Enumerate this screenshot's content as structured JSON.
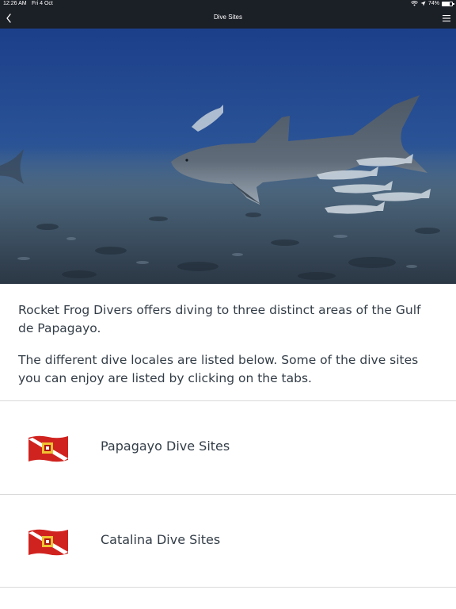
{
  "status_bar": {
    "time": "12:26 AM",
    "date": "Fri 4 Oct",
    "battery": "74%",
    "battery_fraction": 0.74
  },
  "nav": {
    "title": "Dive Sites",
    "back_icon": "chevron-left-icon",
    "menu_icon": "hamburger-menu-icon"
  },
  "intro": {
    "paragraph_1": "Rocket Frog Divers offers diving to three distinct areas of the Gulf de Papagayo.",
    "paragraph_2": "The different dive locales are listed below. Some of the dive sites you can enjoy are listed by clicking on the tabs."
  },
  "dive_sites": [
    {
      "label": "Papagayo Dive Sites",
      "icon": "dive-flag-icon"
    },
    {
      "label": "Catalina Dive Sites",
      "icon": "dive-flag-icon"
    }
  ],
  "colors": {
    "nav_background": "#1b1f26",
    "text": "#333d47",
    "divider": "#d9d9d9",
    "flag_red": "#d0231f"
  }
}
